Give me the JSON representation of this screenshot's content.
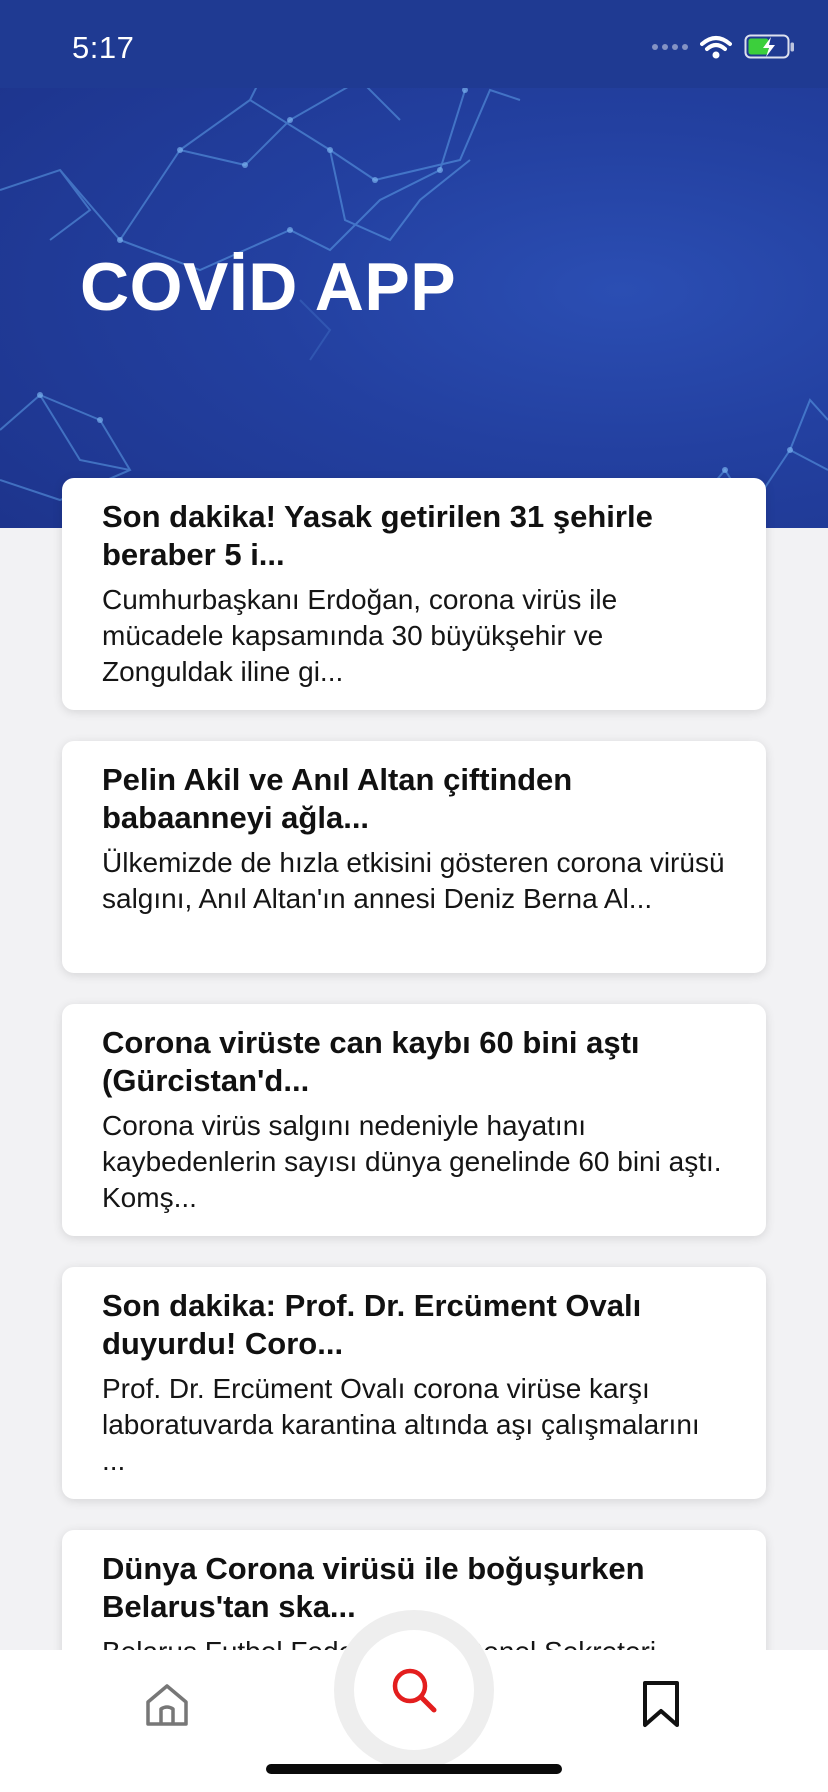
{
  "status_bar": {
    "time": "5:17",
    "icons": [
      "signal-dots-icon",
      "wifi-icon",
      "battery-charging-icon"
    ]
  },
  "header": {
    "title": "COVİD APP"
  },
  "news": [
    {
      "title": "Son dakika! Yasak getirilen 31 şehirle beraber 5 i...",
      "description": "Cumhurbaşkanı Erdoğan, corona virüs ile mücadele kapsamında 30 büyükşehir ve Zonguldak iline gi..."
    },
    {
      "title": "Pelin Akil ve Anıl Altan çiftinden babaanneyi ağla...",
      "description": "Ülkemizde de hızla etkisini gösteren corona virüsü salgını, Anıl Altan'ın annesi Deniz Berna Al..."
    },
    {
      "title": "Corona virüste can kaybı 60 bini aştı (Gürcistan'd...",
      "description": "Corona virüs salgını nedeniyle hayatını kaybedenlerin sayısı dünya genelinde 60 bini aştı. Komş..."
    },
    {
      "title": "Son dakika: Prof. Dr. Ercüment Ovalı duyurdu! Coro...",
      "description": "Prof. Dr. Ercüment Ovalı corona virüse karşı laboratuvarda karantina altında aşı çalışmalarını ..."
    },
    {
      "title": "Dünya Corona virüsü ile boğuşurken Belarus'tan ska...",
      "description": "Belarus Futbol Federasyonu Genel Sekreteri"
    }
  ],
  "bottom_nav": {
    "items": [
      "home-icon",
      "search-icon",
      "bookmark-icon"
    ],
    "active": "search-icon",
    "colors": {
      "active": "#e31e1e",
      "inactive": "#777777"
    }
  },
  "colors": {
    "header_background": "#2340a0",
    "page_background": "#f2f2f4",
    "card_background": "#ffffff"
  }
}
